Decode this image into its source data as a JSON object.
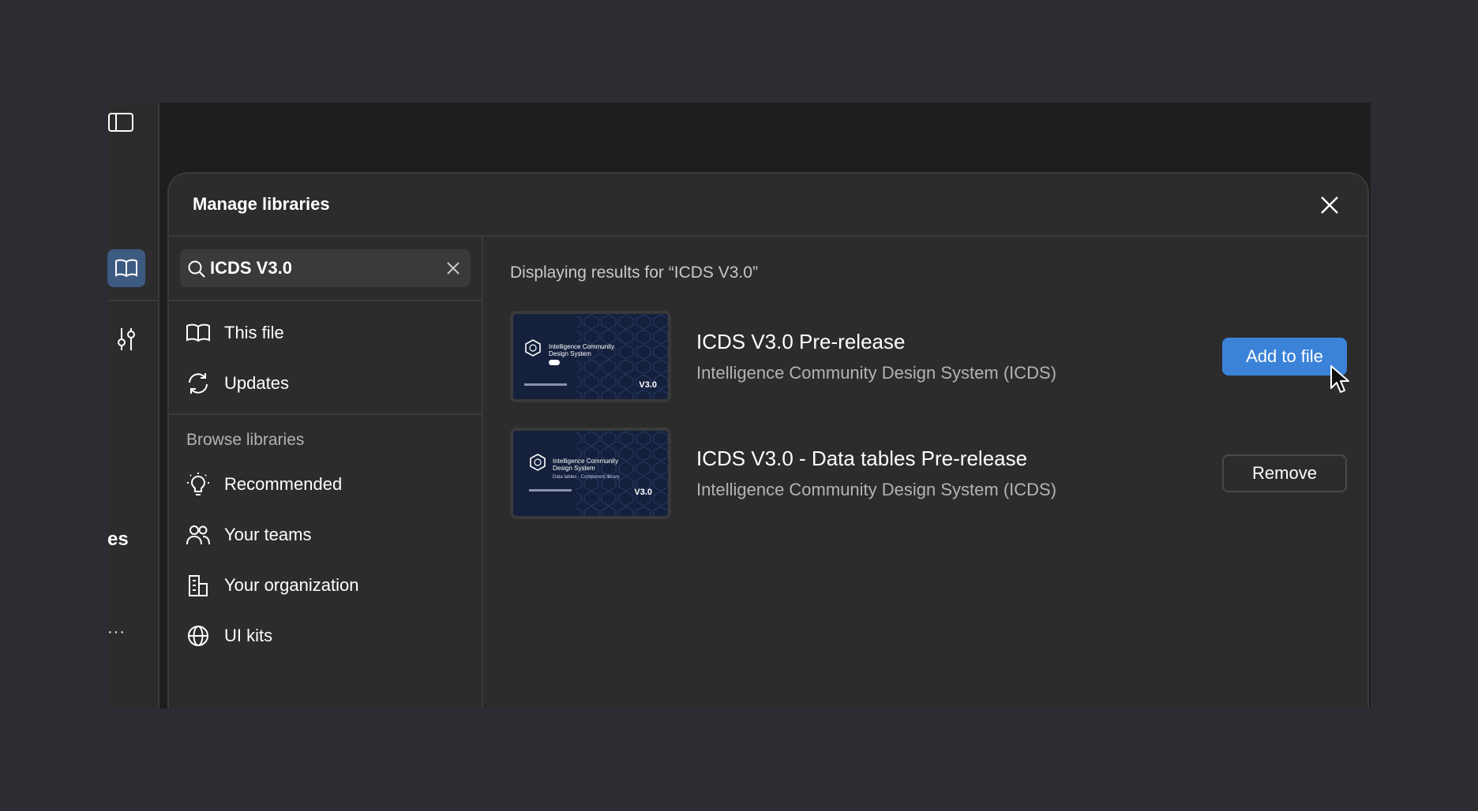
{
  "modal": {
    "title": "Manage libraries"
  },
  "search": {
    "value": "ICDS V3.0",
    "placeholder": "Search"
  },
  "sidebar": {
    "top_items": [
      {
        "label": "This file",
        "icon": "book-icon"
      },
      {
        "label": "Updates",
        "icon": "refresh-icon"
      }
    ],
    "browse_heading": "Browse libraries",
    "browse_items": [
      {
        "label": "Recommended",
        "icon": "lightbulb-icon"
      },
      {
        "label": "Your teams",
        "icon": "people-icon"
      },
      {
        "label": "Your organization",
        "icon": "building-icon"
      },
      {
        "label": "UI kits",
        "icon": "globe-icon"
      }
    ]
  },
  "rail": {
    "partial_label": "es",
    "more_label": "···"
  },
  "results": {
    "label": "Displaying results for “ICDS V3.0”",
    "items": [
      {
        "name": "ICDS V3.0 Pre-release",
        "team": "Intelligence Community Design System (ICDS)",
        "action": "Add to file",
        "thumb_title": "Intelligence Community",
        "thumb_subtitle": "Design System",
        "thumb_version": "V3.0"
      },
      {
        "name": "ICDS V3.0 - Data tables Pre-release",
        "team": "Intelligence Community Design System (ICDS)",
        "action": "Remove",
        "thumb_title": "Intelligence Community",
        "thumb_subtitle": "Design System",
        "thumb_caption": "Data tables - Component library",
        "thumb_version": "V3.0"
      }
    ]
  },
  "colors": {
    "accent": "#3b82d9",
    "background": "#2b2d33",
    "panel": "#2c2c2c"
  }
}
